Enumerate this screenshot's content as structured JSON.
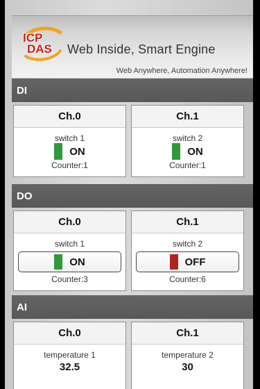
{
  "header": {
    "logo": "ICP DAS",
    "tagline": "Web Inside, Smart Engine",
    "subline": "Web Anywhere, Automation Anywhere!"
  },
  "di": {
    "title": "DI",
    "channels": [
      {
        "name": "Ch.0",
        "label": "switch 1",
        "state": "ON",
        "counter": "Counter:1"
      },
      {
        "name": "Ch.1",
        "label": "switch 2",
        "state": "ON",
        "counter": "Counter:1"
      }
    ]
  },
  "do": {
    "title": "DO",
    "channels": [
      {
        "name": "Ch.0",
        "label": "switch 1",
        "state": "ON",
        "counter": "Counter:3"
      },
      {
        "name": "Ch.1",
        "label": "switch 2",
        "state": "OFF",
        "counter": "Counter:6"
      }
    ]
  },
  "ai": {
    "title": "AI",
    "channels": [
      {
        "name": "Ch.0",
        "label": "temperature 1",
        "value": "32.5"
      },
      {
        "name": "Ch.1",
        "label": "temperature 2",
        "value": "30"
      }
    ]
  },
  "colors": {
    "on": "#2f9a3a",
    "off": "#b0231c",
    "section_bar": "#5e5e5e"
  }
}
